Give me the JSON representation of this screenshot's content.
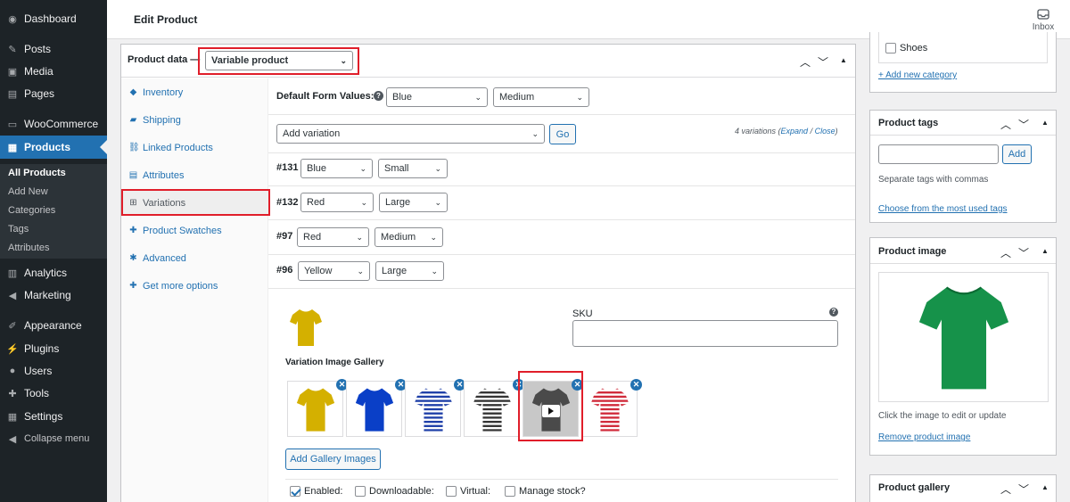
{
  "sidebar": {
    "items": [
      {
        "label": "Dashboard",
        "icon": "dashboard-icon"
      },
      {
        "label": "Posts",
        "icon": "pin-icon"
      },
      {
        "label": "Media",
        "icon": "media-icon"
      },
      {
        "label": "Pages",
        "icon": "pages-icon"
      },
      {
        "label": "WooCommerce",
        "icon": "woo-icon"
      },
      {
        "label": "Products",
        "icon": "products-icon"
      },
      {
        "label": "Analytics",
        "icon": "analytics-icon"
      },
      {
        "label": "Marketing",
        "icon": "megaphone-icon"
      },
      {
        "label": "Appearance",
        "icon": "brush-icon"
      },
      {
        "label": "Plugins",
        "icon": "plugin-icon"
      },
      {
        "label": "Users",
        "icon": "user-icon"
      },
      {
        "label": "Tools",
        "icon": "wrench-icon"
      },
      {
        "label": "Settings",
        "icon": "settings-icon"
      },
      {
        "label": "Collapse menu",
        "icon": "collapse-icon"
      }
    ],
    "submenu": [
      "All Products",
      "Add New",
      "Categories",
      "Tags",
      "Attributes"
    ]
  },
  "header": {
    "title": "Edit Product",
    "inbox": "Inbox"
  },
  "product_data": {
    "label": "Product data —",
    "type": "Variable product",
    "tabs": [
      "Inventory",
      "Shipping",
      "Linked Products",
      "Attributes",
      "Variations",
      "Product Swatches",
      "Advanced",
      "Get more options"
    ],
    "default_form_label": "Default Form Values:",
    "default_color": "Blue",
    "default_size": "Medium",
    "add_variation": "Add variation",
    "go": "Go",
    "variations_count": "4 variations (",
    "expand": "Expand",
    "slash": " / ",
    "close": "Close",
    "close_paren": ")",
    "variations": [
      {
        "id": "#131",
        "color": "Blue",
        "size": "Small"
      },
      {
        "id": "#132",
        "color": "Red",
        "size": "Large"
      },
      {
        "id": "#97",
        "color": "Red",
        "size": "Medium"
      },
      {
        "id": "#96",
        "color": "Yellow",
        "size": "Large"
      }
    ],
    "sku_label": "SKU",
    "sku_value": "",
    "gallery_label": "Variation Image Gallery",
    "gallery_colors": [
      "#d4b000",
      "#0a3fc7",
      "stripe-blue",
      "stripe-gray",
      "#4a4a4a",
      "stripe-red"
    ],
    "add_gallery": "Add Gallery Images",
    "enabled": "Enabled:",
    "downloadable": "Downloadable:",
    "virtual": "Virtual:",
    "manage_stock": "Manage stock?"
  },
  "right": {
    "category_shoes": "Shoes",
    "add_category": "+ Add new category",
    "tags_title": "Product tags",
    "add_btn": "Add",
    "tags_hint": "Separate tags with commas",
    "choose_tags": "Choose from the most used tags",
    "image_title": "Product image",
    "image_hint": "Click the image to edit or update",
    "remove_image": "Remove product image",
    "gallery_title": "Product gallery"
  },
  "colors": {
    "accent": "#2271b1",
    "sidebar": "#1d2327",
    "highlight": "#e01e2a",
    "shirt_green": "#16924a"
  }
}
